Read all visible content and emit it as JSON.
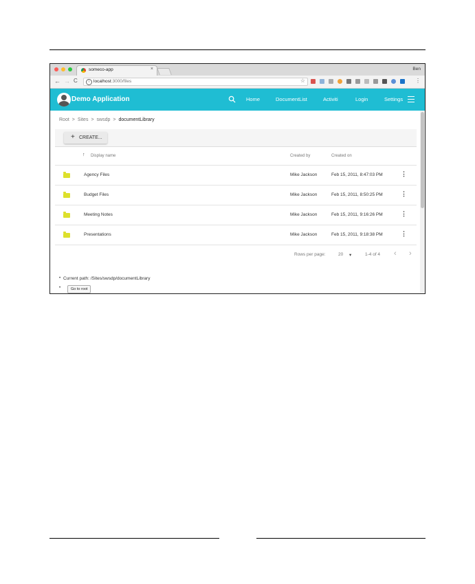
{
  "browser": {
    "tab_title": "someco-app",
    "tab_close": "×",
    "user_name": "Ben",
    "url_host": "localhost",
    "url_path": ":3000/files",
    "nav": {
      "back": "←",
      "forward": "→",
      "reload": "C"
    },
    "star": "☆",
    "menu": "⋮",
    "traffic_lights": {
      "close": "#fc5b57",
      "minimize": "#fdbc2e",
      "maximize": "#2bc840"
    }
  },
  "header": {
    "title": "Demo Application",
    "nav": [
      "Home",
      "DocumentList",
      "Activiti",
      "Login",
      "Settings"
    ],
    "accent": "#1fbdd3"
  },
  "breadcrumb": {
    "items": [
      "Root",
      "Sites",
      "swsdp"
    ],
    "separator": ">",
    "current": "documentLibrary"
  },
  "toolbar": {
    "create_icon": "+",
    "create_label": "CREATE..."
  },
  "table": {
    "sort_icon": "↑",
    "columns": {
      "name": "Display name",
      "created_by": "Created by",
      "created_on": "Created on"
    },
    "rows": [
      {
        "name": "Agency Files",
        "created_by": "Mike Jackson",
        "created_on": "Feb 15, 2011, 8:47:03 PM"
      },
      {
        "name": "Budget Files",
        "created_by": "Mike Jackson",
        "created_on": "Feb 15, 2011, 8:50:25 PM"
      },
      {
        "name": "Meeting Notes",
        "created_by": "Mike Jackson",
        "created_on": "Feb 15, 2011, 9:16:26 PM"
      },
      {
        "name": "Presentations",
        "created_by": "Mike Jackson",
        "created_on": "Feb 15, 2011, 9:18:38 PM"
      }
    ],
    "row_menu": "⋮",
    "folder_color": "#dde02c"
  },
  "pagination": {
    "rows_per_page_label": "Rows per page:",
    "rows_per_page": "20",
    "dropdown_icon": "▾",
    "range": "1-4 of 4",
    "prev": "‹",
    "next": "›"
  },
  "footer": {
    "bullet": "•",
    "current_path": "Current path: /Sites/swsdp/documentLibrary",
    "go_root_label": "Go to root"
  }
}
